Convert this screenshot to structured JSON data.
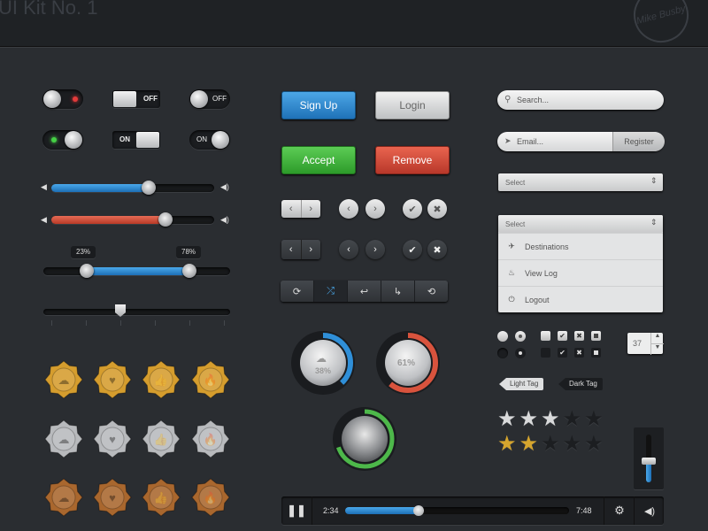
{
  "header": {
    "title": "UI Kit No. 1",
    "logo_text": "Mike Busby"
  },
  "toggles": {
    "switch1_label": "OFF",
    "switch2_label": "ON",
    "switch3_label": "OFF",
    "switch4_label": "ON",
    "switch5_label": "ON"
  },
  "sliders": {
    "volume1_level": 0.6,
    "volume2_level": 0.7,
    "range_low_label": "23%",
    "range_high_label": "78%",
    "range_low": 0.23,
    "range_high": 0.78,
    "step_position": 0.41
  },
  "buttons": {
    "signup": "Sign Up",
    "login": "Login",
    "accept": "Accept",
    "remove": "Remove"
  },
  "form": {
    "search_placeholder": "Search...",
    "email_placeholder": "Email...",
    "register": "Register",
    "select_label": "Select",
    "select2_label": "Select",
    "menu_items": [
      "Destinations",
      "View Log",
      "Logout"
    ],
    "stepper_value": "37",
    "light_tag": "Light Tag",
    "dark_tag": "Dark Tag"
  },
  "ratings": {
    "row1": 3,
    "row2": 2,
    "total": 5
  },
  "dials": {
    "dial1_value": "38%",
    "dial1_fraction": 0.38,
    "dial2_value": "61%",
    "dial2_fraction": 0.61,
    "dial3_fraction": 0.7
  },
  "colors": {
    "blue": "#2f8fd8",
    "red": "#d8533d",
    "green": "#4db84a",
    "gold": "#d59d2e",
    "silver": "#b8babd",
    "bronze": "#a9672e"
  },
  "badges": {
    "icons": [
      "cloud-icon",
      "heart-icon",
      "thumbs-up-icon",
      "flame-icon"
    ]
  },
  "player": {
    "elapsed": "2:34",
    "total": "7:48",
    "progress": 0.33
  },
  "vertical_slider": {
    "level": 0.45
  }
}
